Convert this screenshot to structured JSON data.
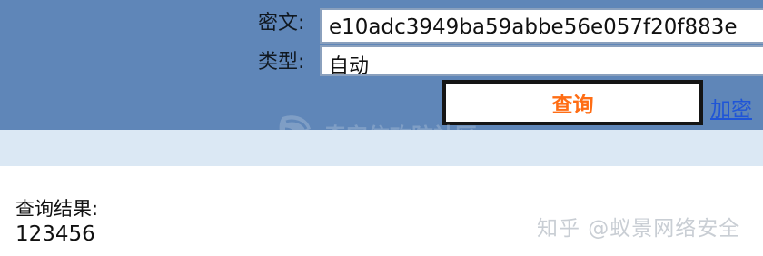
{
  "query_form": {
    "cipher_label": "密文:",
    "cipher_value": "e10adc3949ba59abbe56e057f20f883e",
    "type_label": "类型:",
    "type_value": "自动",
    "query_button": "查询",
    "encrypt_link": "加密"
  },
  "result": {
    "label": "查询结果:",
    "value": "123456"
  },
  "watermarks": {
    "center_icon": "feather-shield-icon",
    "center_text": "奇安信攻防社区",
    "credit": "知乎 @蚁景网络安全"
  },
  "colors": {
    "panel": "#5f86b8",
    "band": "#dbe8f4",
    "button_text": "#ff6d14",
    "link": "#1f55d7"
  }
}
